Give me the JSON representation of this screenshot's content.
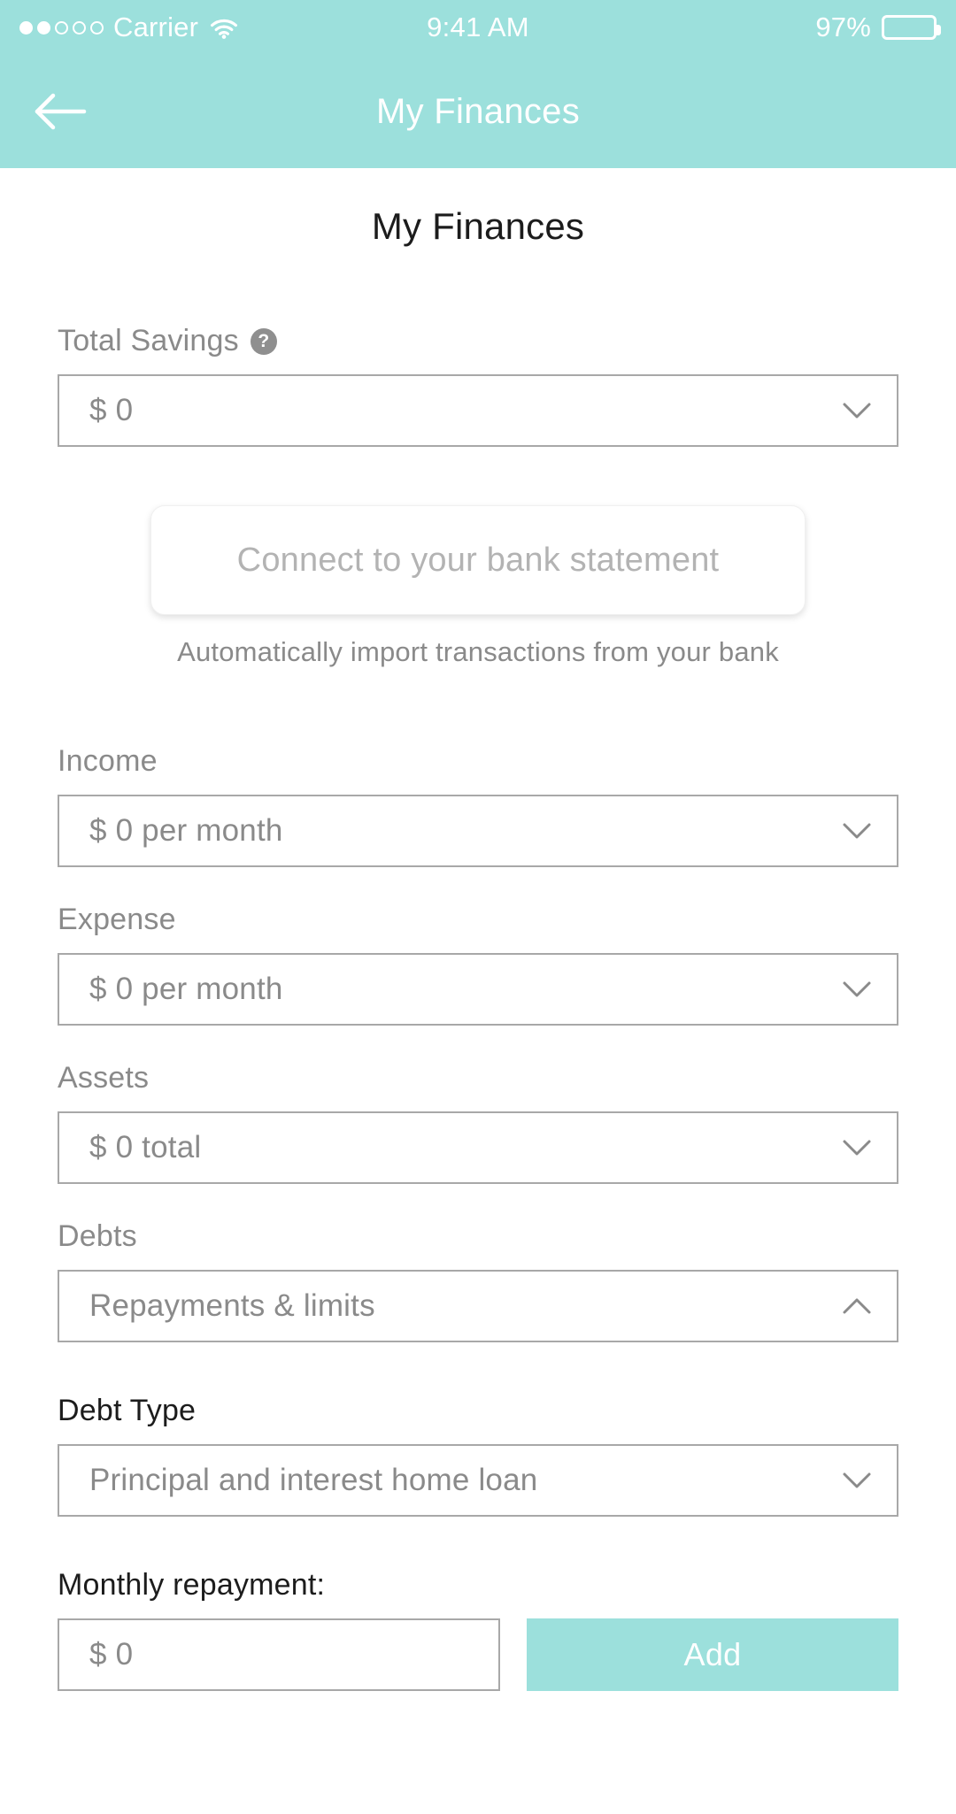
{
  "status_bar": {
    "carrier": "Carrier",
    "signal_dots_filled": 2,
    "signal_dots_total": 5,
    "wifi_icon": "wifi-icon",
    "time": "9:41 AM",
    "battery_percent": "97%",
    "battery_level": 97
  },
  "nav": {
    "back_icon": "arrow-left-icon",
    "title": "My Finances"
  },
  "page": {
    "title": "My Finances"
  },
  "total_savings": {
    "label": "Total Savings",
    "help_icon": "question-mark-icon",
    "value": "$ 0",
    "chevron": "chevron-down-icon"
  },
  "bank_connect": {
    "button_label": "Connect to your bank statement",
    "hint": "Automatically import transactions from your bank"
  },
  "income": {
    "label": "Income",
    "value": "$ 0 per month",
    "chevron": "chevron-down-icon"
  },
  "expense": {
    "label": "Expense",
    "value": "$ 0 per month",
    "chevron": "chevron-down-icon"
  },
  "assets": {
    "label": "Assets",
    "value": "$ 0 total",
    "chevron": "chevron-down-icon"
  },
  "debts": {
    "label": "Debts",
    "value": "Repayments & limits",
    "chevron": "chevron-up-icon"
  },
  "debt_type": {
    "label": "Debt Type",
    "value": "Principal and interest home loan",
    "chevron": "chevron-down-icon"
  },
  "monthly_repayment": {
    "label": "Monthly repayment:",
    "amount_value": "$ 0",
    "add_label": "Add"
  },
  "colors": {
    "accent_teal": "#9CE0DC",
    "field_border": "#A8A8A8",
    "muted_text": "#8A8A8A",
    "dark_text": "#1C1C1C",
    "placeholder_light": "#B3B3B3"
  }
}
